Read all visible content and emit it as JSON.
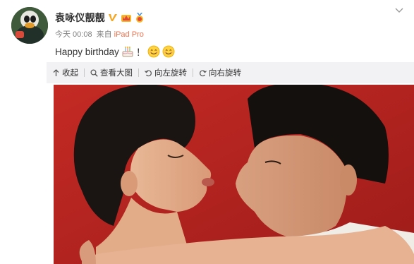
{
  "post": {
    "user_name": "袁咏仪靓靓",
    "time": "今天 00:08",
    "source_prefix": "来自",
    "source": "iPad Pro",
    "text_main": "Happy birthday",
    "text_punct": "！"
  },
  "toolbar": {
    "items": [
      {
        "label": "收起",
        "icon": "collapse-icon"
      },
      {
        "label": "查看大图",
        "icon": "zoom-icon"
      },
      {
        "label": "向左旋转",
        "icon": "rotate-left-icon"
      },
      {
        "label": "向右旋转",
        "icon": "rotate-right-icon"
      }
    ]
  },
  "colors": {
    "link": "#eb7350",
    "badge": "#f5a623",
    "photo_bg": "#b3221f",
    "toolbar_bg": "#f2f2f5"
  }
}
